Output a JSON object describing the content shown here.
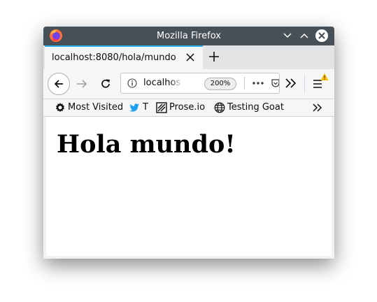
{
  "window": {
    "title": "Mozilla Firefox"
  },
  "tabs": [
    {
      "label": "localhost:8080/hola/mundo",
      "active": true
    }
  ],
  "navbar": {
    "url": "localhost",
    "zoom": "200%"
  },
  "bookmarks": [
    {
      "label": "Most Visited",
      "icon": "gear-icon"
    },
    {
      "label": "T",
      "icon": "twitter-bird-icon"
    },
    {
      "label": "Prose.io",
      "icon": "prose-icon"
    },
    {
      "label": "Testing Goat",
      "icon": "globe-icon"
    }
  ],
  "page": {
    "heading": "Hola mundo!"
  },
  "colors": {
    "titlebar": "#475057",
    "tab_accent": "#2cb1f0",
    "toolbar": "#f5f6f7",
    "warning": "#ffbf00",
    "twitter": "#1da1f2"
  }
}
